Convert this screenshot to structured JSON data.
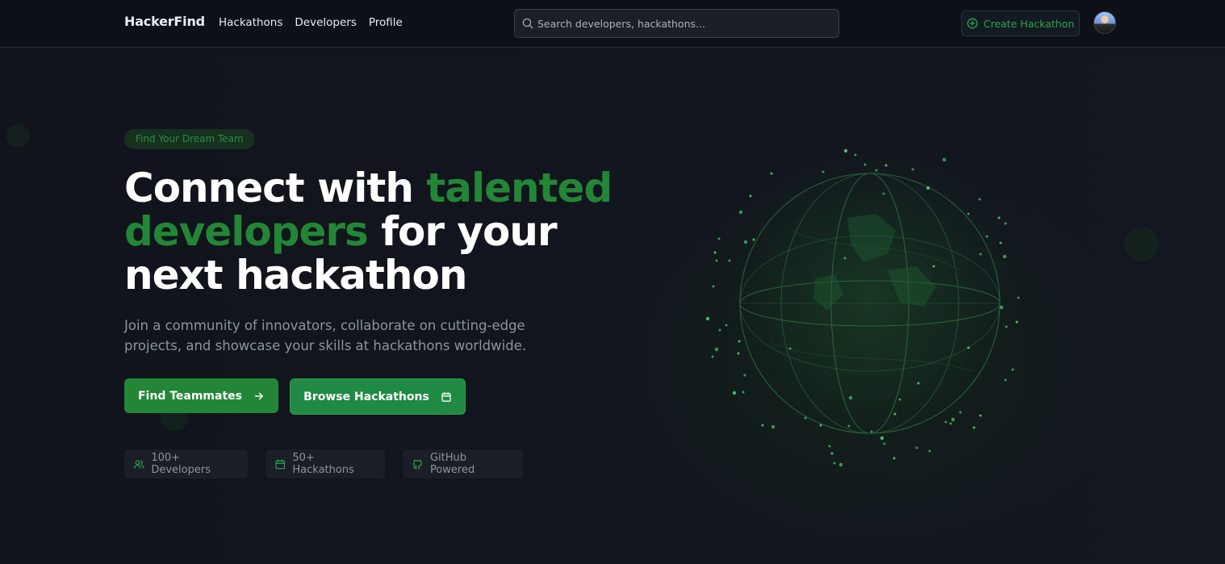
{
  "nav": {
    "brand": "HackerFind",
    "links": [
      "Hackathons",
      "Developers",
      "Profile"
    ],
    "search_placeholder": "Search developers, hackathons...",
    "create_label": "Create Hackathon",
    "search_icon": "search-icon",
    "create_icon": "plus-circle-icon"
  },
  "hero": {
    "badge": "Find Your Dream Team",
    "headline_part1": "Connect with ",
    "headline_accent": "talented developers",
    "headline_part2": " for your next hackathon",
    "subtitle": "Join a community of innovators, collaborate on cutting-edge projects, and showcase your skills at hackathons worldwide.",
    "primary_button": "Find Teammates",
    "primary_icon": "arrow-right-icon",
    "secondary_button": "Browse Hackathons",
    "secondary_icon": "calendar-icon"
  },
  "stats": [
    {
      "label": "100+ Developers",
      "icon": "users-icon"
    },
    {
      "label": "50+ Hackathons",
      "icon": "calendar-icon"
    },
    {
      "label": "GitHub Powered",
      "icon": "github-icon"
    }
  ],
  "colors": {
    "accent": "#238636",
    "accent_bright": "#2da44e",
    "background": "#11141b",
    "nav_bg": "#0d1117",
    "muted_text": "#8b949e"
  }
}
